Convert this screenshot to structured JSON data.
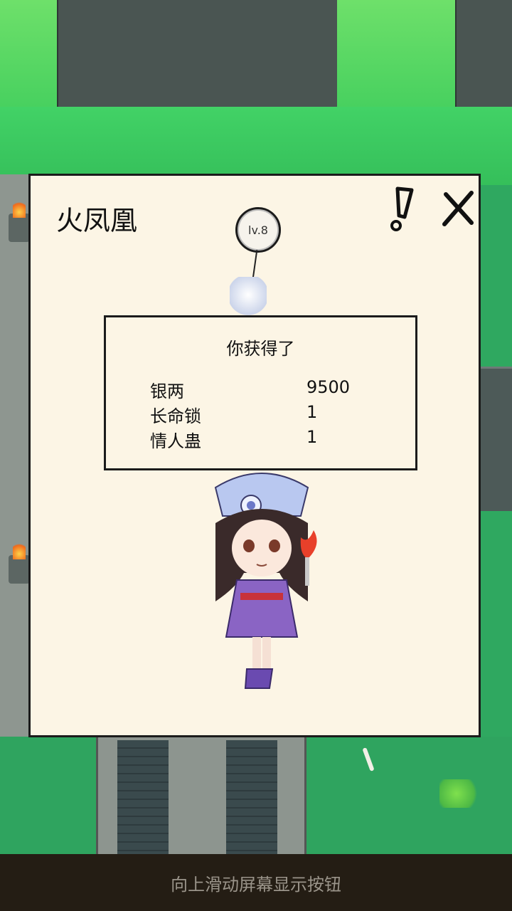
{
  "dialog": {
    "title": "火凤凰",
    "level": "lv.8",
    "reward": {
      "heading": "你获得了",
      "items": [
        {
          "name": "银两",
          "qty": "9500"
        },
        {
          "name": "长命锁",
          "qty": "1"
        },
        {
          "name": "情人蛊",
          "qty": "1"
        }
      ]
    },
    "icons": {
      "info": "exclamation-icon",
      "close": "close-icon"
    }
  },
  "bottom_bar": {
    "hint": "向上滑动屏幕显示按钮"
  },
  "colors": {
    "water": "#42d266",
    "dialog_bg": "#fcf5e5",
    "border": "#1b1b1b",
    "bottom_bar": "#241d14",
    "hint_text": "#9a948a"
  }
}
